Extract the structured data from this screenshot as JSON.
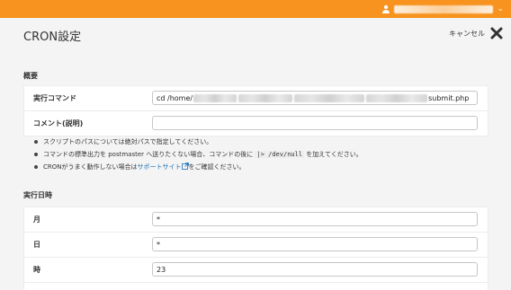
{
  "header": {
    "user_icon": "user-icon",
    "chevron_icon": "chevron-down-icon",
    "chevron_glyph": "⌄"
  },
  "page": {
    "title": "CRON設定",
    "cancel_label": "キャンセル",
    "cancel_icon": "close-icon"
  },
  "overview": {
    "section_title": "概要",
    "command_label": "実行コマンド",
    "command_prefix": "cd /home/",
    "command_suffix": "submit.php",
    "comment_label": "コメント(説明)",
    "comment_value": ""
  },
  "notes": {
    "note1": "スクリプトのパスについては絶対パスで指定してください。",
    "note2_before": "コマンドの標準出力を postmaster へ送りたくない場合、コマンドの後に ",
    "note2_code": "|> /dev/null",
    "note2_after": " を加えてください。",
    "note3_before": "CRONがうまく動作しない場合は",
    "note3_link": "サポートサイト",
    "note3_after": "をご確認ください。",
    "external_icon": "external-link-icon"
  },
  "schedule": {
    "section_title": "実行日時",
    "month_label": "月",
    "month_value": "*",
    "day_label": "日",
    "day_value": "*",
    "hour_label": "時",
    "hour_value": "23"
  },
  "colors": {
    "header": "#f7931e",
    "link": "#1a6fb5"
  }
}
